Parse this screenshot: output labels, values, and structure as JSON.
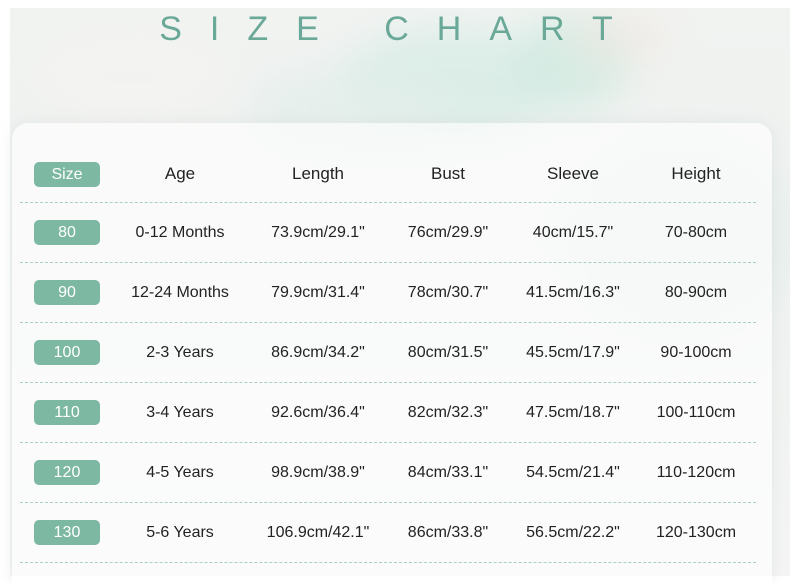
{
  "title": "SIZE CHART",
  "accent_color": "#7db8a3",
  "title_color": "#6aa898",
  "table": {
    "headers": [
      "Size",
      "Age",
      "Length",
      "Bust",
      "Sleeve",
      "Height"
    ],
    "rows": [
      [
        "80",
        "0-12 Months",
        "73.9cm/29.1\"",
        "76cm/29.9\"",
        "40cm/15.7\"",
        "70-80cm"
      ],
      [
        "90",
        "12-24 Months",
        "79.9cm/31.4\"",
        "78cm/30.7\"",
        "41.5cm/16.3\"",
        "80-90cm"
      ],
      [
        "100",
        "2-3 Years",
        "86.9cm/34.2\"",
        "80cm/31.5\"",
        "45.5cm/17.9\"",
        "90-100cm"
      ],
      [
        "110",
        "3-4 Years",
        "92.6cm/36.4\"",
        "82cm/32.3\"",
        "47.5cm/18.7\"",
        "100-110cm"
      ],
      [
        "120",
        "4-5 Years",
        "98.9cm/38.9\"",
        "84cm/33.1\"",
        "54.5cm/21.4\"",
        "110-120cm"
      ],
      [
        "130",
        "5-6 Years",
        "106.9cm/42.1\"",
        "86cm/33.8\"",
        "56.5cm/22.2\"",
        "120-130cm"
      ]
    ]
  }
}
